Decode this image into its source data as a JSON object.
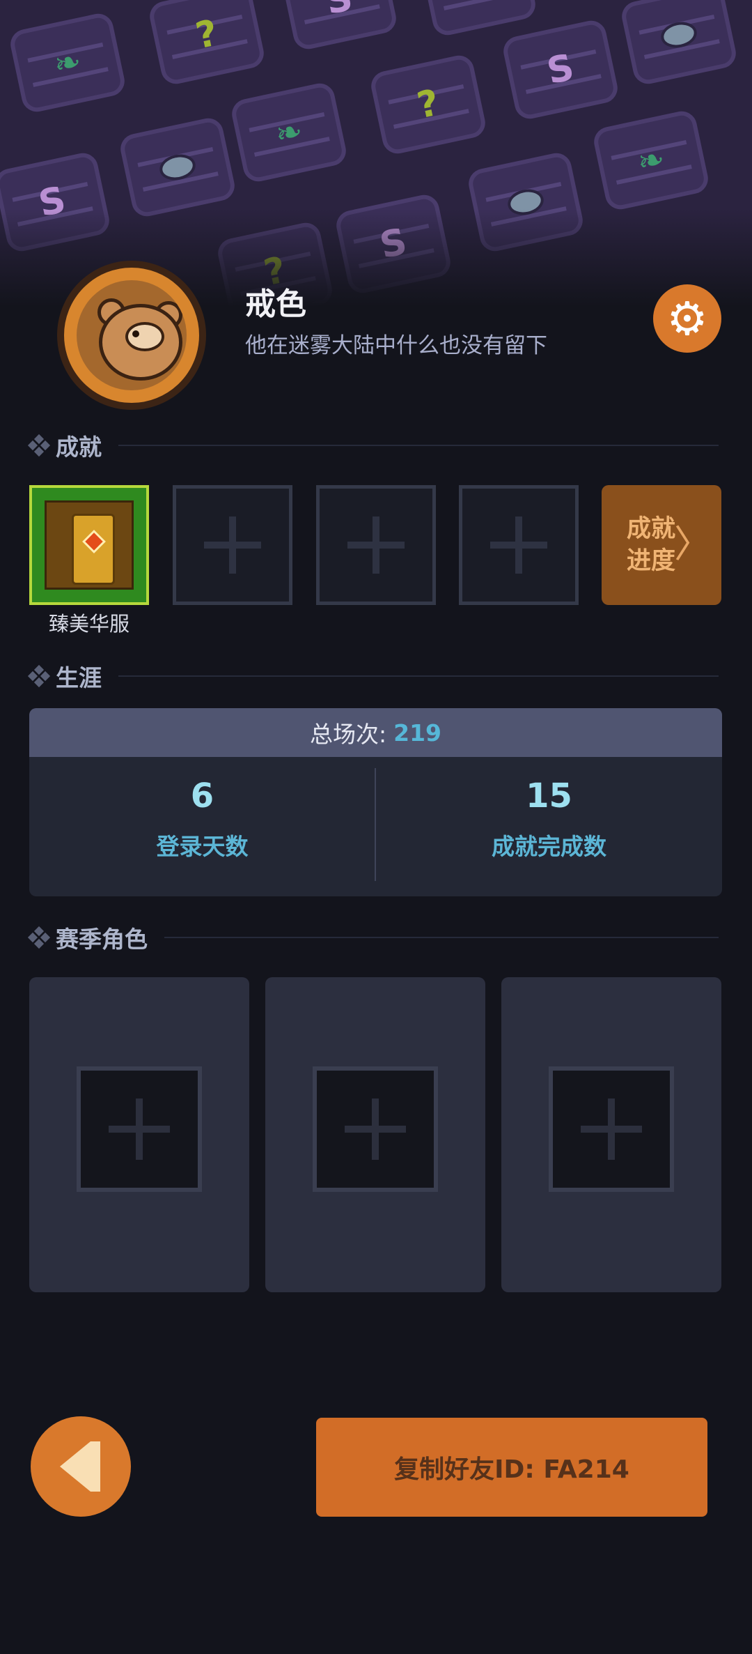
{
  "profile": {
    "username": "戒色",
    "bio": "他在迷雾大陆中什么也没有留下"
  },
  "sections": {
    "achievements": "成就",
    "career": "生涯",
    "season_roles": "赛季角色"
  },
  "achievements": {
    "equipped": [
      {
        "label": "臻美华服"
      }
    ],
    "empty_slots": 3,
    "progress_button_line1": "成就",
    "progress_button_line2": "进度"
  },
  "career": {
    "total_matches_label": "总场次:",
    "total_matches_value": "219",
    "stats": [
      {
        "value": "6",
        "label": "登录天数"
      },
      {
        "value": "15",
        "label": "成就完成数"
      }
    ]
  },
  "season_roles": {
    "empty_slots": 3
  },
  "bottom": {
    "copy_button_label": "复制好友ID: FA214",
    "back_icon": "back-arrow-icon"
  },
  "colors": {
    "background": "#13141c",
    "accent_orange": "#d9792c",
    "stat_blue": "#5cb6d6",
    "banner_purple": "#2b2340"
  }
}
